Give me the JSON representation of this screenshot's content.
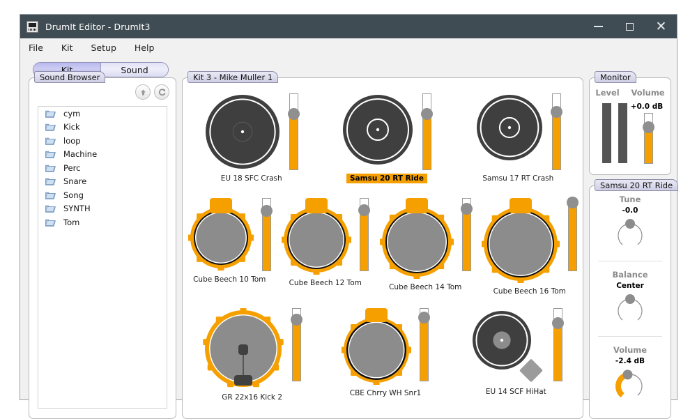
{
  "window": {
    "title": "DrumIt Editor - DrumIt3",
    "icon": "app-icon",
    "controls": {
      "minimize": "minimize-icon",
      "maximize": "maximize-icon",
      "close": "close-icon"
    },
    "titlebar_color": "#3f4c54"
  },
  "menu": {
    "items": [
      "File",
      "Kit",
      "Setup",
      "Help"
    ]
  },
  "mode_toggle": {
    "options": [
      "Kit",
      "Sound"
    ],
    "selected": "Kit"
  },
  "browser": {
    "tab_label": "Sound Browser",
    "tools": [
      {
        "name": "up-icon",
        "glyph": "up"
      },
      {
        "name": "refresh-icon",
        "glyph": "refresh"
      }
    ],
    "folders": [
      "cym",
      "Kick",
      "loop",
      "Machine",
      "Perc",
      "Snare",
      "Song",
      "SYNTH",
      "Tom"
    ]
  },
  "kit": {
    "tab_label": "Kit 3 - Mike Muller 1",
    "selected_pad": "Samsu 20 RT Ride",
    "accent_color": "#f5a000",
    "rows": [
      {
        "name": "cymbal-row",
        "pads": [
          {
            "label": "EU 18 SFC Crash",
            "type": "cymbal",
            "size": 110,
            "bell": "small",
            "selected": false,
            "slider": 74
          },
          {
            "label": "Samsu 20 RT Ride",
            "type": "cymbal",
            "size": 104,
            "bell": "large",
            "selected": true,
            "slider": 74
          },
          {
            "label": "Samsu 17 RT Crash",
            "type": "cymbal",
            "size": 98,
            "bell": "large",
            "selected": false,
            "slider": 76
          }
        ]
      },
      {
        "name": "tom-row",
        "pads": [
          {
            "label": "Cube Beech 10 Tom",
            "type": "tom",
            "size": 94,
            "selected": false,
            "slider": 83
          },
          {
            "label": "Cube Beech 12 Tom",
            "type": "tom",
            "size": 100,
            "selected": false,
            "slider": 84
          },
          {
            "label": "Cube Beech 14 Tom",
            "type": "tom",
            "size": 106,
            "selected": false,
            "slider": 86
          },
          {
            "label": "Cube Beech 16 Tom",
            "type": "tom",
            "size": 112,
            "selected": false,
            "slider": 94
          }
        ]
      },
      {
        "name": "kick-row",
        "pads": [
          {
            "label": "GR 22x16 Kick 2",
            "type": "kick",
            "size": 116,
            "selected": false,
            "slider": 85
          },
          {
            "label": "CBE Chrry WH Snr1",
            "type": "snare",
            "size": 100,
            "selected": false,
            "slider": 88
          },
          {
            "label": "EU 14 SCF HiHat",
            "type": "hihat",
            "size": 92,
            "selected": false,
            "slider": 80
          }
        ]
      }
    ]
  },
  "monitor": {
    "tab_label": "Monitor",
    "level_label": "Level",
    "volume_label": "Volume",
    "volume_value": "+0.0 dB",
    "volume_slider": 72,
    "meters": [
      0,
      0
    ]
  },
  "sound": {
    "tab_label": "Samsu 20 RT Ride",
    "controls": [
      {
        "name": "tune",
        "label": "Tune",
        "value": "-0.0",
        "angle": 0,
        "fill": false
      },
      {
        "name": "balance",
        "label": "Balance",
        "value": "Center",
        "angle": 0,
        "fill": false
      },
      {
        "name": "volume",
        "label": "Volume",
        "value": "-2.4 dB",
        "angle": 128,
        "fill": true
      }
    ]
  }
}
